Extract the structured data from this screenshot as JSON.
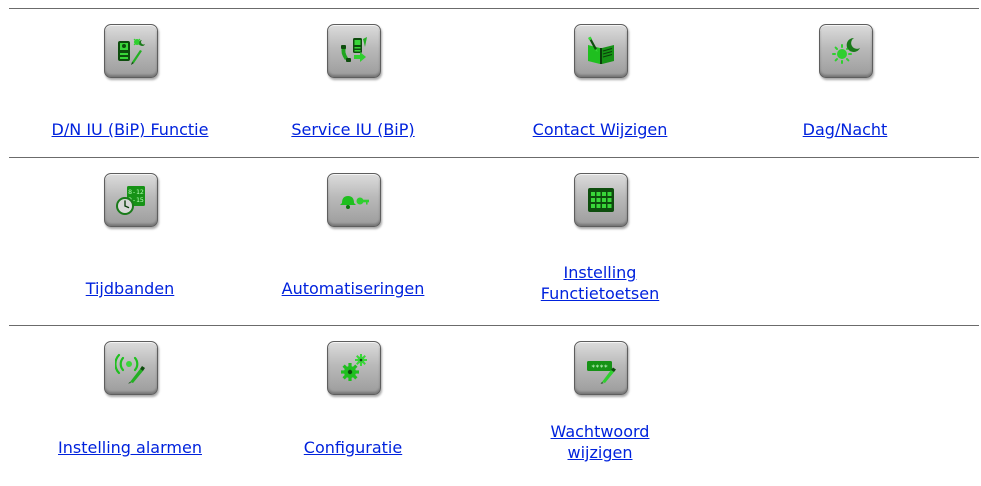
{
  "rows": [
    {
      "items": [
        {
          "icon": "intercom-day-night-icon",
          "label": "D/N IU (BiP) Functie"
        },
        {
          "icon": "service-intercom-icon",
          "label": "Service IU (BiP)"
        },
        {
          "icon": "address-book-edit-icon",
          "label": "Contact Wijzigen"
        },
        {
          "icon": "sun-moon-icon",
          "label": "Dag/Nacht"
        }
      ]
    },
    {
      "items": [
        {
          "icon": "clock-timeband-icon",
          "label": "Tijdbanden"
        },
        {
          "icon": "bell-key-icon",
          "label": "Automatiseringen"
        },
        {
          "icon": "keypad-grid-icon",
          "label_line1": "Instelling",
          "label_line2": "Functietoetsen"
        }
      ]
    },
    {
      "items": [
        {
          "icon": "alarm-signal-icon",
          "label": "Instelling alarmen"
        },
        {
          "icon": "gears-icon",
          "label": "Configuratie"
        },
        {
          "icon": "password-edit-icon",
          "label_line1": "Wachtwoord",
          "label_line2": "wijzigen"
        }
      ]
    }
  ],
  "colors": {
    "link": "#0022dd",
    "icon_green": "#1fbf1f",
    "icon_dark": "#0a3d0a",
    "tile": "#bdbdbd"
  }
}
